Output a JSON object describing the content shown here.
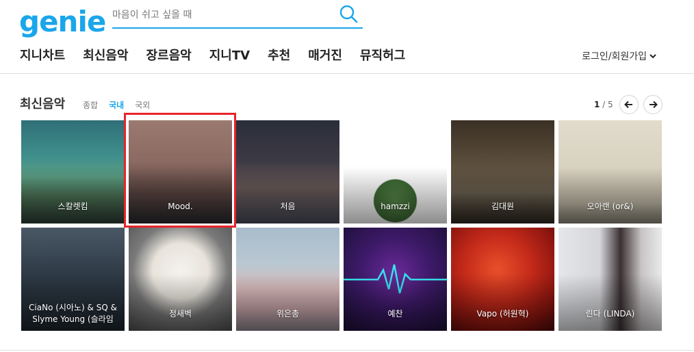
{
  "brand": {
    "logo_text": "genie",
    "color": "#1aa6ea"
  },
  "search": {
    "placeholder": "마음이 쉬고 싶을 때",
    "value": "",
    "icon": "search-icon"
  },
  "nav": {
    "items": [
      "지니차트",
      "최신음악",
      "장르음악",
      "지니TV",
      "추천",
      "매거진",
      "뮤직허그"
    ],
    "login": "로그인/회원가입"
  },
  "section": {
    "title": "최신음악",
    "tabs": [
      "종합",
      "국내",
      "국외"
    ],
    "active_tab": "국내",
    "page_current": "1",
    "page_separator": " / ",
    "page_total": "5"
  },
  "albums": [
    "스칼렛킴",
    "Mood.",
    "처음",
    "hamzzi",
    "김대원",
    "오아랜 (or&)",
    "CiaNo (시아노) & SQ & Slyme Young (슬라임",
    "정새벽",
    "위은총",
    "예찬",
    "Vapo (허원혁)",
    "린다 (LINDA)"
  ],
  "highlight_color": "#e8232b"
}
